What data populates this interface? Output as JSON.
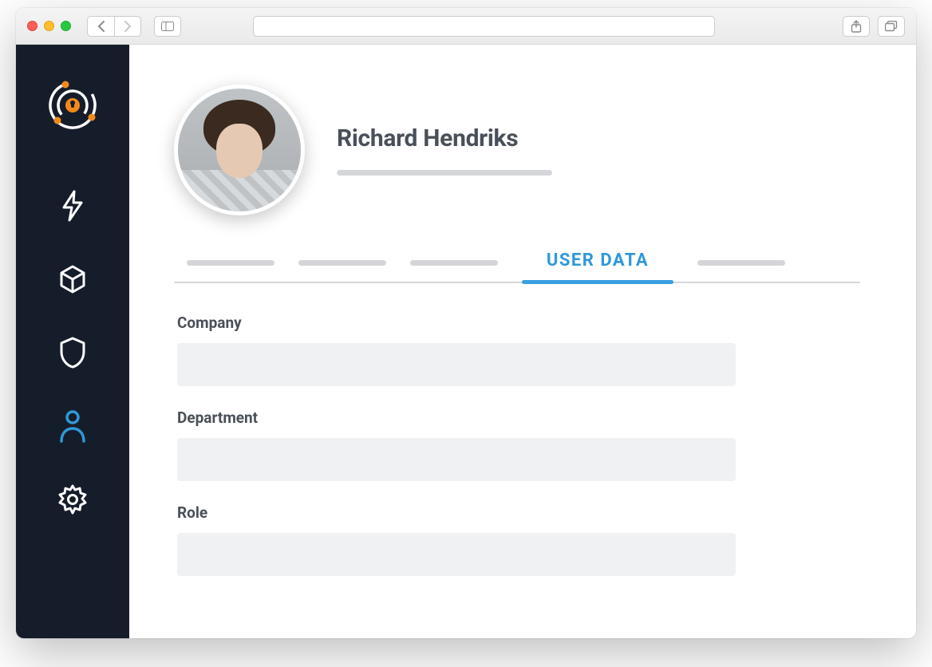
{
  "browser": {
    "url": ""
  },
  "profile": {
    "name": "Richard Hendriks"
  },
  "tabs": {
    "active_label": "USER DATA",
    "placeholders": [
      110,
      110,
      110,
      null,
      110
    ],
    "active_index": 3
  },
  "form": {
    "fields": [
      {
        "label": "Company",
        "value": ""
      },
      {
        "label": "Department",
        "value": ""
      },
      {
        "label": "Role",
        "value": ""
      }
    ]
  },
  "sidebar": {
    "icons": [
      "bolt",
      "cube",
      "shield",
      "user",
      "gear"
    ],
    "active": "user"
  },
  "colors": {
    "accent": "#2f98d9",
    "sidebar_bg": "#161d2a",
    "logo_orange": "#f28a1a"
  }
}
